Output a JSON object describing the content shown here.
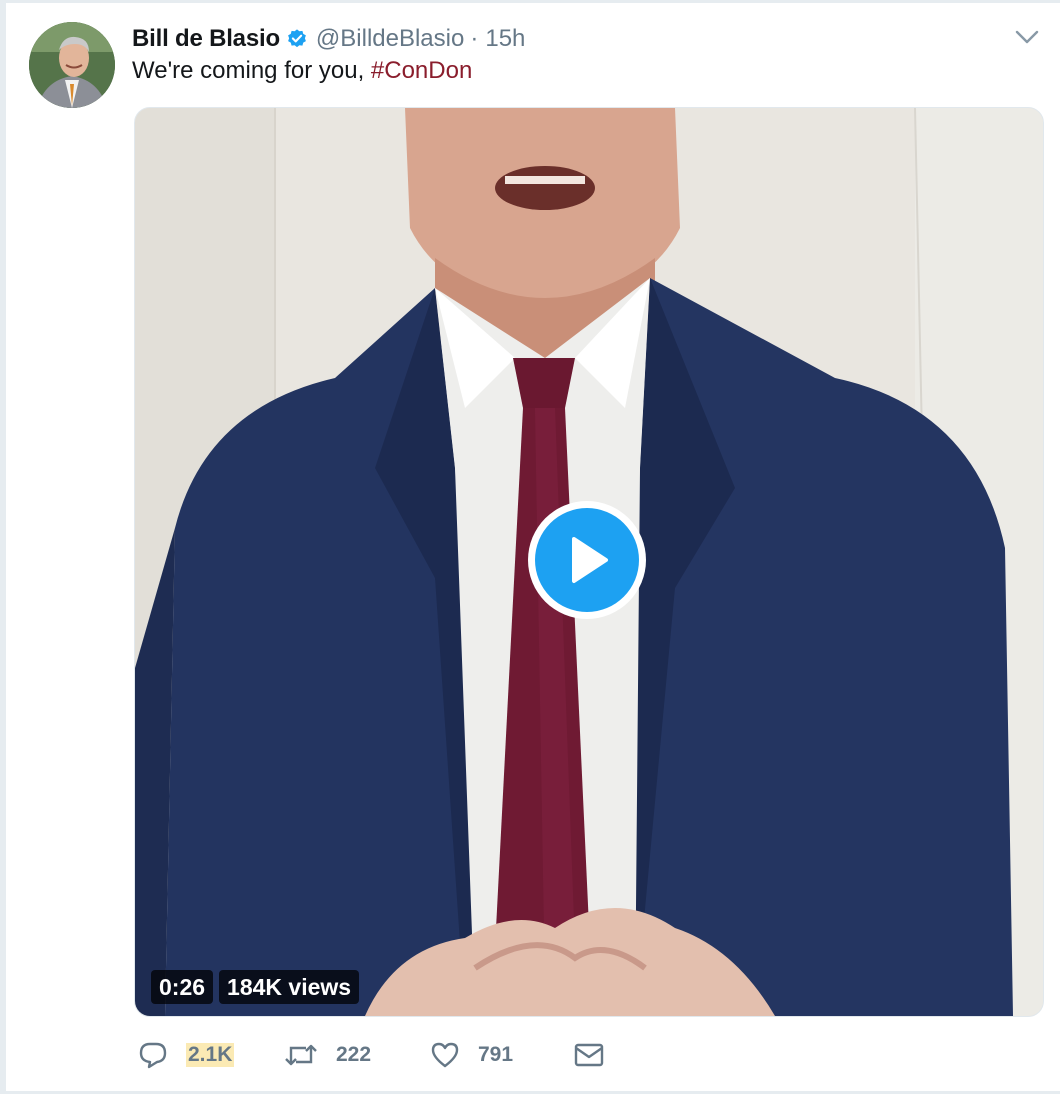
{
  "tweet": {
    "display_name": "Bill de Blasio",
    "handle": "@BilldeBlasio",
    "separator": "·",
    "time": "15h",
    "text_prefix": "We're coming for you, ",
    "hashtag": "#ConDon"
  },
  "video": {
    "duration": "0:26",
    "views": "184K views"
  },
  "actions": {
    "replies": "2.1K",
    "retweets": "222",
    "likes": "791"
  },
  "icons": {
    "verified": "verified-badge-icon",
    "caret": "chevron-down-icon",
    "play": "play-icon",
    "reply": "reply-icon",
    "retweet": "retweet-icon",
    "like": "heart-icon",
    "dm": "envelope-icon"
  },
  "colors": {
    "accent": "#1da1f2",
    "hashtag": "#8a1d2c",
    "muted": "#657786",
    "text": "#14171a"
  }
}
